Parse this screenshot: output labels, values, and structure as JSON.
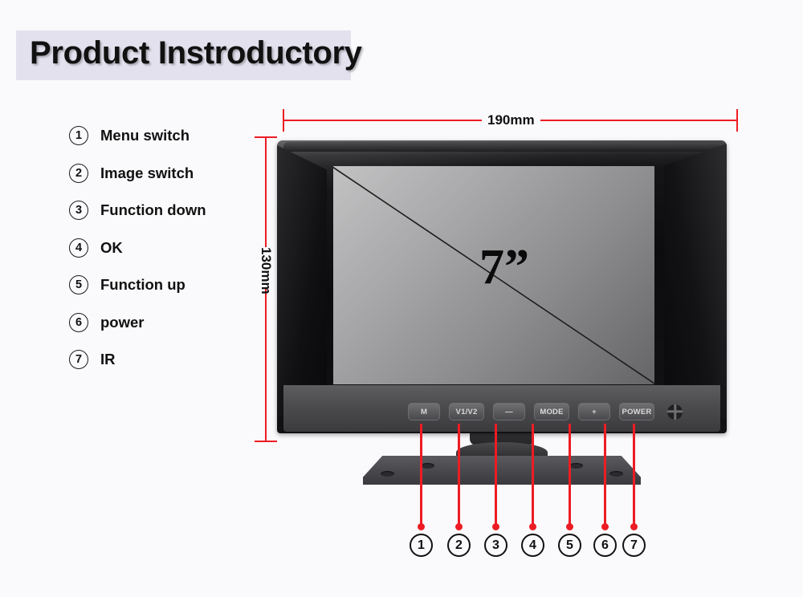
{
  "page": {
    "background_color": "#faf9fb",
    "accent_color": "#ed1c24",
    "title_band_color": "#e2e1ed"
  },
  "header": {
    "title": "Product Instroductory"
  },
  "legend": {
    "items": [
      {
        "num": "1",
        "label": "Menu  switch"
      },
      {
        "num": "2",
        "label": "Image switch"
      },
      {
        "num": "3",
        "label": "Function  down"
      },
      {
        "num": "4",
        "label": "OK"
      },
      {
        "num": "5",
        "label": "Function  up"
      },
      {
        "num": "6",
        "label": "power"
      },
      {
        "num": "7",
        "label": "IR"
      }
    ]
  },
  "dimensions": {
    "width_label": "190mm",
    "height_label": "130mm"
  },
  "monitor": {
    "screen_size_label": "7”",
    "buttons": [
      {
        "id": "menu",
        "label": "M"
      },
      {
        "id": "image-switch",
        "label": "V1/V2"
      },
      {
        "id": "function-down",
        "label": "—"
      },
      {
        "id": "mode",
        "label": "MODE"
      },
      {
        "id": "function-up",
        "label": "+"
      },
      {
        "id": "power",
        "label": "POWER"
      },
      {
        "id": "ir",
        "label": ""
      }
    ]
  },
  "callouts": {
    "numbers": [
      "1",
      "2",
      "3",
      "4",
      "5",
      "6",
      "7"
    ]
  }
}
